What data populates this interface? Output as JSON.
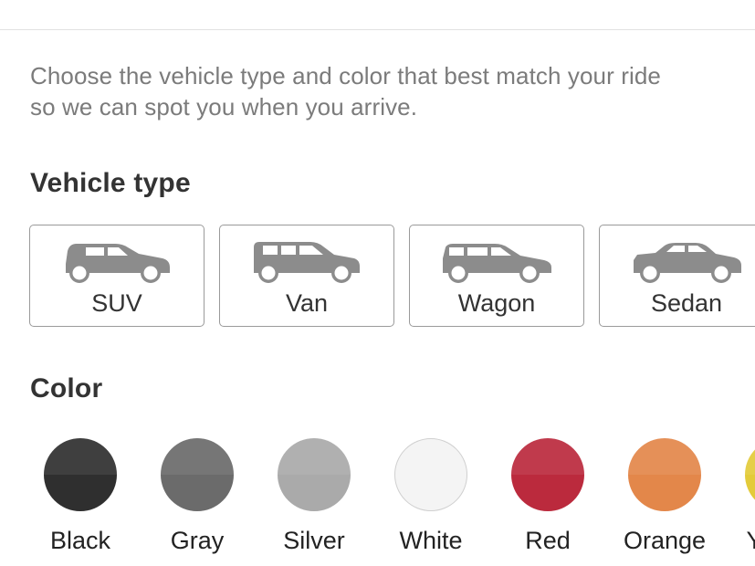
{
  "intro": {
    "line1": "Choose the vehicle type and color that best match your ride",
    "line2": "so we can spot you when you arrive."
  },
  "vehicle_section": {
    "title": "Vehicle type",
    "types": [
      {
        "label": "SUV",
        "icon": "suv-icon"
      },
      {
        "label": "Van",
        "icon": "van-icon"
      },
      {
        "label": "Wagon",
        "icon": "wagon-icon"
      },
      {
        "label": "Sedan",
        "icon": "sedan-icon"
      }
    ],
    "icon_color": "#8c8c8c"
  },
  "color_section": {
    "title": "Color",
    "colors": [
      {
        "label": "Black",
        "hex": "#2f2f2f"
      },
      {
        "label": "Gray",
        "hex": "#6b6b6b"
      },
      {
        "label": "Silver",
        "hex": "#aaaaaa"
      },
      {
        "label": "White",
        "hex": "#f4f4f4"
      },
      {
        "label": "Red",
        "hex": "#bb2a3d"
      },
      {
        "label": "Orange",
        "hex": "#e3874a"
      },
      {
        "label": "Yellow",
        "hex": "#e3cb3a"
      }
    ]
  }
}
